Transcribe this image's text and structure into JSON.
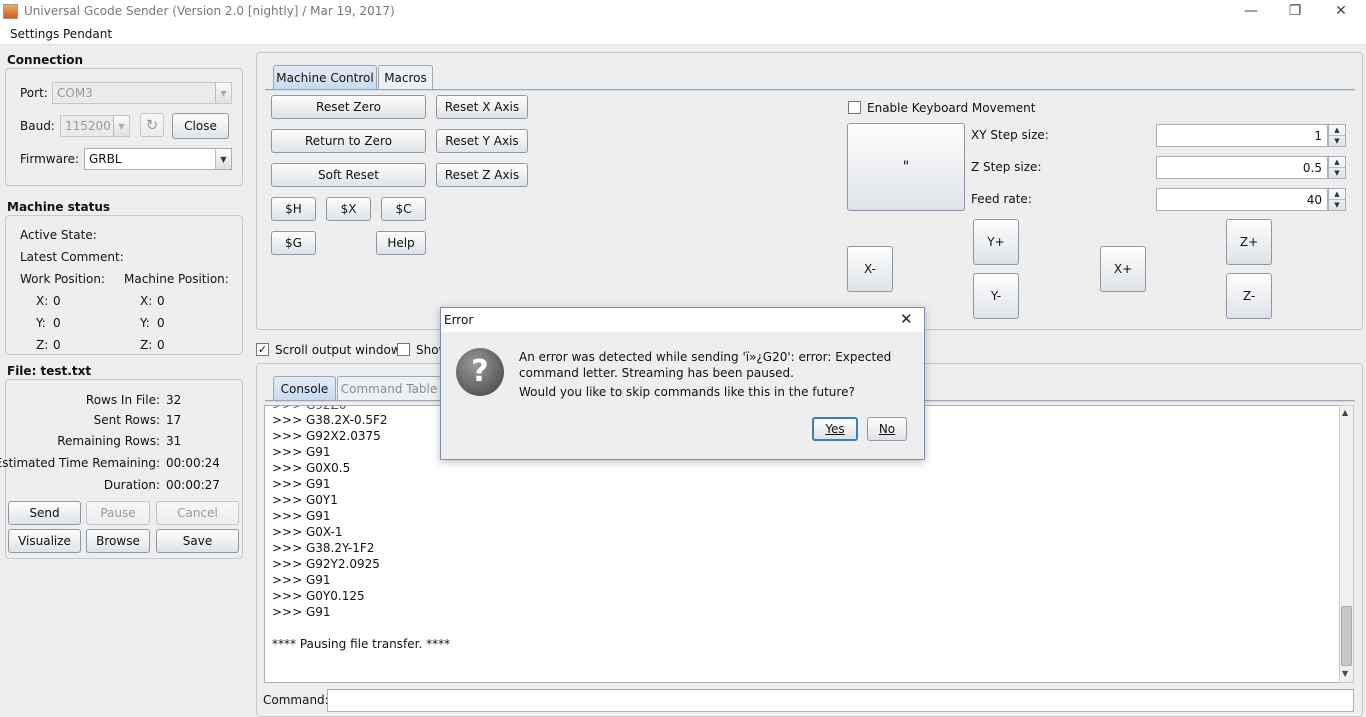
{
  "window": {
    "title": "Universal Gcode Sender (Version 2.0 [nightly]  / Mar 19, 2017)",
    "minimize": "—",
    "restore": "❐",
    "close": "✕"
  },
  "menu": {
    "settings": "Settings",
    "pendant": "Pendant"
  },
  "connection": {
    "heading": "Connection",
    "port_label": "Port:",
    "port_value": "COM3",
    "baud_label": "Baud:",
    "baud_value": "115200",
    "refresh_icon": "↻",
    "close_button": "Close",
    "firmware_label": "Firmware:",
    "firmware_value": "GRBL"
  },
  "machine_status": {
    "heading": "Machine status",
    "active_state": "Active State:",
    "latest_comment": "Latest Comment:",
    "work_position": "Work Position:",
    "machine_position": "Machine Position:",
    "work": {
      "x_label": "X:",
      "x": "0",
      "y_label": "Y:",
      "y": "0",
      "z_label": "Z:",
      "z": "0"
    },
    "machine": {
      "x_label": "X:",
      "x": "0",
      "y_label": "Y:",
      "y": "0",
      "z_label": "Z:",
      "z": "0"
    }
  },
  "file": {
    "heading": "File: test.txt",
    "rows_in_file_label": "Rows In File:",
    "rows_in_file": "32",
    "sent_rows_label": "Sent Rows:",
    "sent_rows": "17",
    "remaining_rows_label": "Remaining Rows:",
    "remaining_rows": "31",
    "est_time_label": "Estimated Time Remaining:",
    "est_time": "00:00:24",
    "duration_label": "Duration:",
    "duration": "00:00:27",
    "send": "Send",
    "pause": "Pause",
    "cancel": "Cancel",
    "visualize": "Visualize",
    "browse": "Browse",
    "save": "Save"
  },
  "control_tabs": {
    "machine_control": "Machine Control",
    "macros": "Macros"
  },
  "machine_control": {
    "reset_zero": "Reset Zero",
    "return_to_zero": "Return to Zero",
    "soft_reset": "Soft Reset",
    "reset_x": "Reset X Axis",
    "reset_y": "Reset Y Axis",
    "reset_z": "Reset Z Axis",
    "h": "$H",
    "x": "$X",
    "c": "$C",
    "g": "$G",
    "help": "Help",
    "enable_keyboard": "Enable Keyboard Movement",
    "big_button": "\"",
    "xy_step_label": "XY Step size:",
    "xy_step": "1",
    "z_step_label": "Z Step size:",
    "z_step": "0.5",
    "feed_label": "Feed rate:",
    "feed": "40",
    "x_minus": "X-",
    "x_plus": "X+",
    "y_plus": "Y+",
    "y_minus": "Y-",
    "z_plus": "Z+",
    "z_minus": "Z-"
  },
  "options": {
    "scroll_output": "Scroll output window",
    "show_verbose": "Show"
  },
  "console_tabs": {
    "console": "Console",
    "command_table": "Command Table"
  },
  "console_lines": [
    ">>> G38.2X-0.5F2",
    ">>> G92X2.0375",
    ">>> G91",
    ">>> G0X0.5",
    ">>> G91",
    ">>> G0Y1",
    ">>> G91",
    ">>> G0X-1",
    ">>> G38.2Y-1F2",
    ">>> G92Y2.0925",
    ">>> G91",
    ">>> G0Y0.125",
    ">>> G91",
    "",
    "**** Pausing file transfer. ****"
  ],
  "command": {
    "label": "Command:",
    "value": ""
  },
  "dialog": {
    "title": "Error",
    "close": "✕",
    "icon": "?",
    "line1": "An error was detected while sending 'ï»¿G20': error: Expected",
    "line2": "command letter. Streaming has been paused.",
    "line3": "Would you like to skip commands like this in the future?",
    "yes": "Yes",
    "no": "No"
  }
}
